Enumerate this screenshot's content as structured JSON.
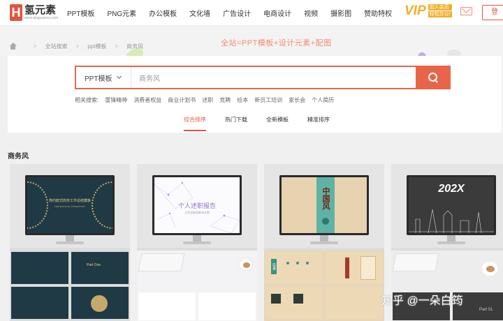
{
  "logo": {
    "name": "氢元素",
    "sub": "www.qingyuansu.com"
  },
  "nav": [
    "PPT模板",
    "PNG元素",
    "办公模板",
    "文化墙",
    "广告设计",
    "电商设计",
    "视频",
    "摄影图",
    "赞助特权"
  ],
  "vip": {
    "big": "VIP",
    "line1": "加入会员",
    "line2": "轻松办公!"
  },
  "login_label": "登",
  "banner_slogan": "全站=PPT模板+设计元素+配图",
  "breadcrumb": [
    "全站搜索",
    "ppt模板",
    "商务风"
  ],
  "search": {
    "category": "PPT模板",
    "value": "商务风"
  },
  "related": {
    "label": "相关搜索:",
    "items": [
      "雷锋精神",
      "消费者权益",
      "商业计划书",
      "述职",
      "竞聘",
      "绘本",
      "新员工培训",
      "家长会",
      "个人简历"
    ]
  },
  "sort_tabs": [
    "综合排序",
    "热门下载",
    "全新模板",
    "精准排序"
  ],
  "category_title": "商务风",
  "cards": [
    {
      "screen_text": "简约欧式商务工作总结模板",
      "screen_sub": "PROFESSIONAL POWERPOINT",
      "lower_text": "Part One"
    },
    {
      "screen_text": "个人述职报告",
      "screen_sub": "工作总结及新年计划"
    },
    {
      "screen_text": "中国风",
      "lower_text": "目录"
    },
    {
      "screen_text": "202X",
      "lower_text": "Part 01"
    }
  ],
  "watermark": "知乎 @一朵白筠",
  "colors": {
    "accent": "#e8654a",
    "vip": "#f0b02c"
  }
}
